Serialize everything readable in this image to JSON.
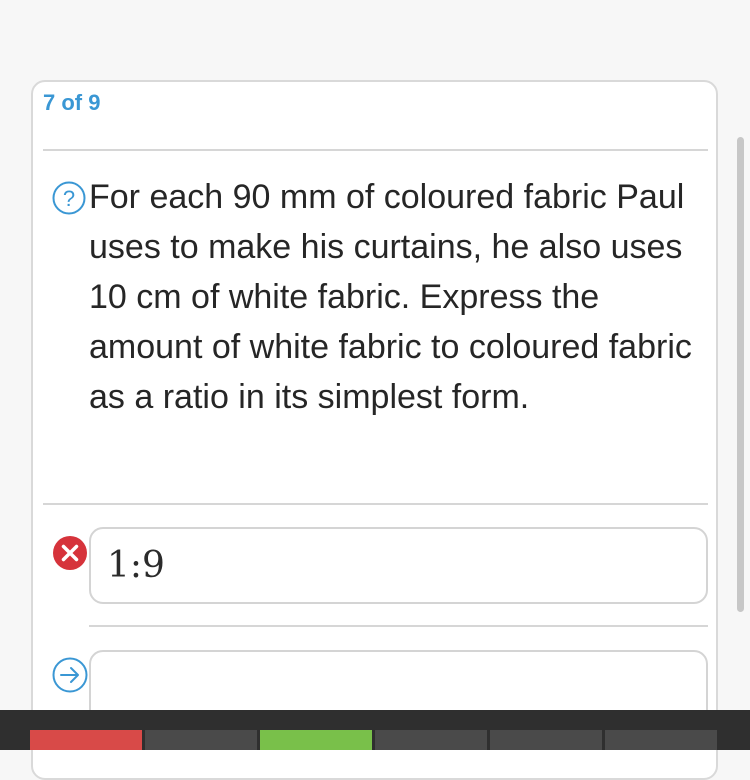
{
  "progress": {
    "label": "7 of 9",
    "current": 7,
    "total": 9
  },
  "question": {
    "icon": "question-circle-icon",
    "text": "For each 90 mm of coloured fabric Paul uses to make his curtains, he also uses 10 cm of white fabric. Express the amount of white fabric to coloured fabric as a ratio in its simplest form."
  },
  "answer": {
    "status_icon": "wrong-x-icon",
    "value": "1:9",
    "status": "incorrect"
  },
  "next_input": {
    "icon": "arrow-right-circle-icon",
    "value": ""
  },
  "colors": {
    "accent": "#3a97d4",
    "wrong": "#d6333b",
    "tab_red": "#d84a48",
    "tab_green": "#79c04a",
    "tab_gray": "#4a4a4a"
  }
}
